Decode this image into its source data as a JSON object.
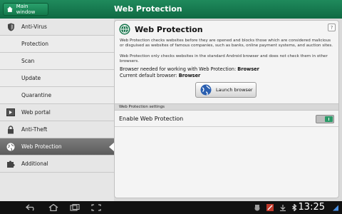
{
  "header": {
    "back_label": "Main window",
    "title": "Web Protection"
  },
  "sidebar": {
    "items": [
      {
        "label": "Anti-Virus",
        "icon": "shield-icon",
        "level": "top"
      },
      {
        "label": "Protection",
        "level": "sub"
      },
      {
        "label": "Scan",
        "level": "sub"
      },
      {
        "label": "Update",
        "level": "sub"
      },
      {
        "label": "Quarantine",
        "level": "sub"
      },
      {
        "label": "Web portal",
        "icon": "web-portal-icon",
        "level": "top"
      },
      {
        "label": "Anti-Theft",
        "icon": "lock-icon",
        "level": "top"
      },
      {
        "label": "Web Protection",
        "icon": "globe-icon",
        "level": "top",
        "active": true
      },
      {
        "label": "Additional",
        "icon": "puzzle-icon",
        "level": "top"
      }
    ]
  },
  "panel": {
    "title": "Web Protection",
    "help": "?",
    "desc1": "Web Protection checks websites before they are opened and blocks those which are considered malicious or disguised as websites of famous companies, such as banks, online payment systems, and auction sites.",
    "desc2": "Web Protection only checks websites in the standard Android browser and does not check them in other browsers.",
    "browser_needed_label": "Browser needed for working with Web Protection:",
    "browser_needed_value": "Browser",
    "default_browser_label": "Current default browser:",
    "default_browser_value": "Browser",
    "launch_button": "Launch browser",
    "settings_header": "Web Protection settings",
    "enable_label": "Enable Web Protection",
    "enable_on": true
  },
  "statusbar": {
    "time": "13:25"
  },
  "colors": {
    "accent_green": "#1f8a5c",
    "active_item": "#6a6a6a"
  }
}
